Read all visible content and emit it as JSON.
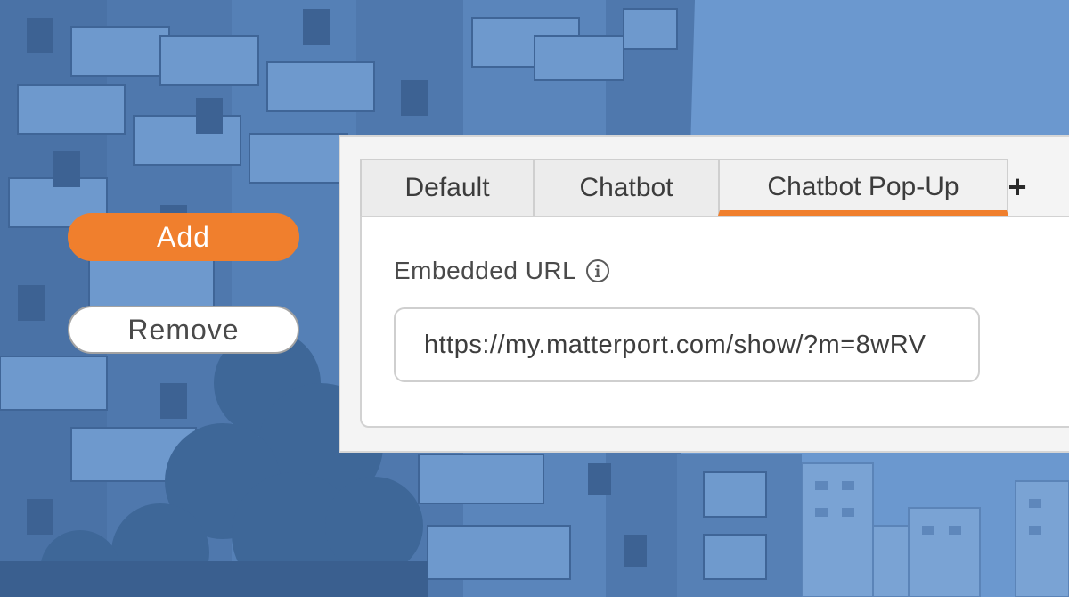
{
  "sidebar": {
    "add_label": "Add",
    "remove_label": "Remove"
  },
  "panel": {
    "tabs": [
      {
        "label": "Default"
      },
      {
        "label": "Chatbot"
      },
      {
        "label": "Chatbot Pop-Up",
        "active": true
      }
    ],
    "add_tab_label": "+",
    "field": {
      "label": "Embedded URL",
      "value": "https://my.matterport.com/show/?m=8wRV"
    }
  },
  "colors": {
    "accent": "#f07f2d",
    "background_tint": "#6591c9",
    "panel_bg": "#f4f4f4"
  },
  "icons": {
    "info": "info-circle-icon",
    "add_tab": "plus-icon"
  }
}
